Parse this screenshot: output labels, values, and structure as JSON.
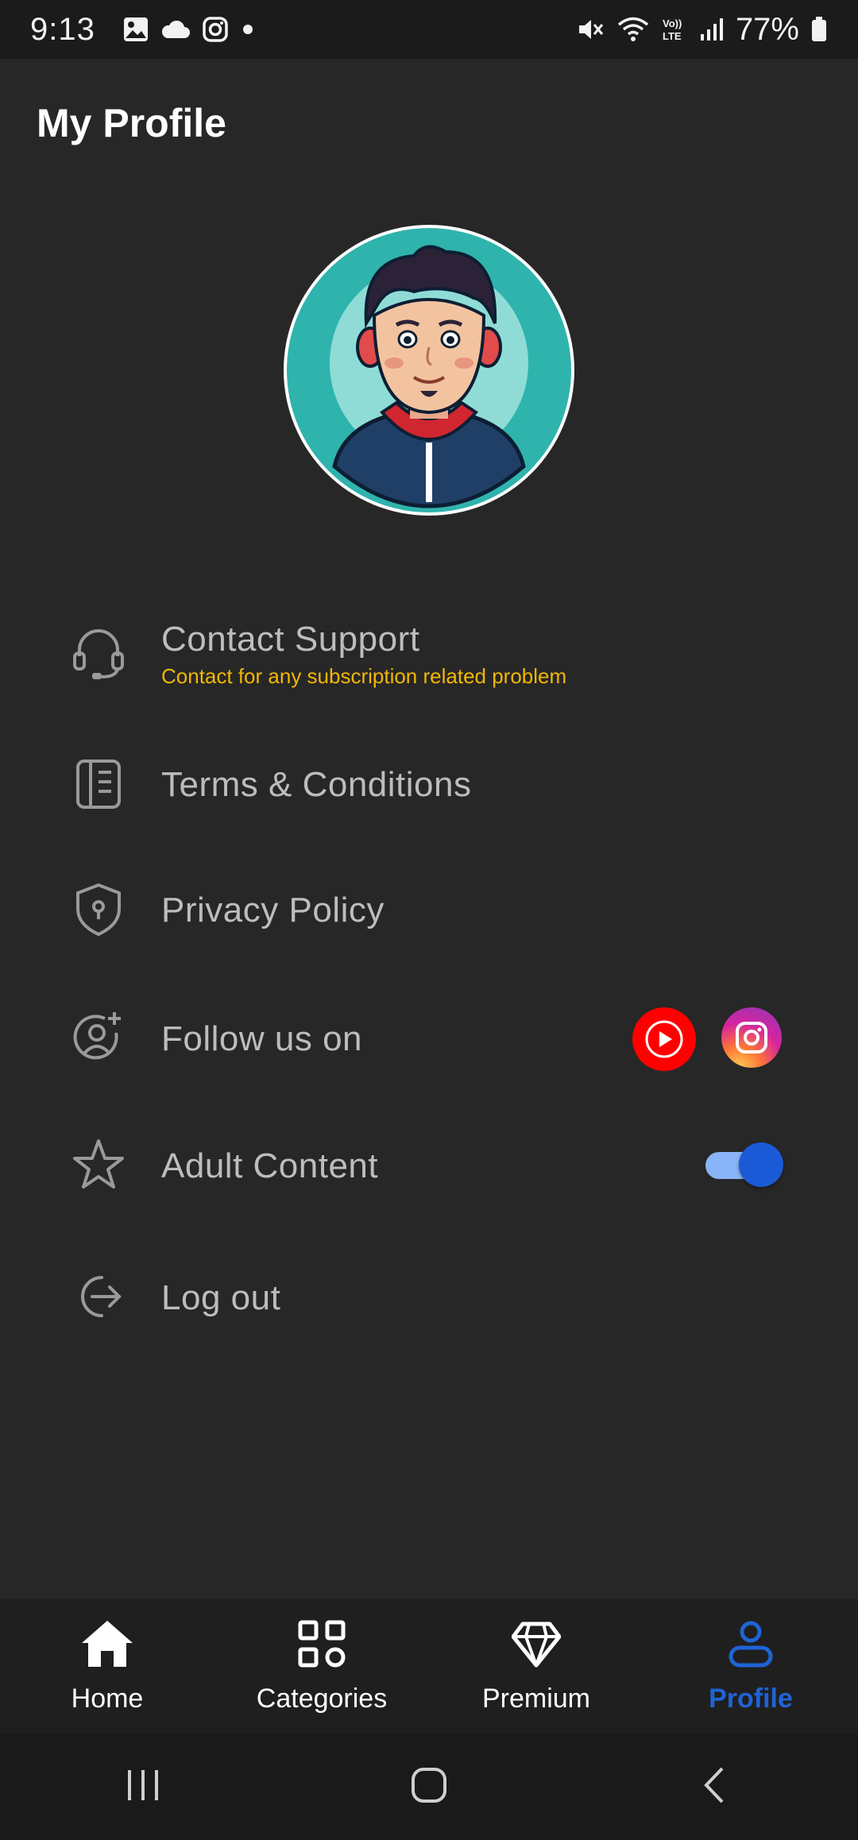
{
  "status_bar": {
    "time": "9:13",
    "battery": "77%",
    "icons": [
      "gallery-icon",
      "cloud-icon",
      "instagram-icon",
      "dot-icon",
      "mute-icon",
      "wifi-icon",
      "volte-icon",
      "signal-icon",
      "battery-icon"
    ]
  },
  "header": {
    "title": "My Profile"
  },
  "menu": {
    "contact_support": {
      "label": "Contact Support",
      "subtitle": "Contact for any subscription related problem",
      "icon": "headset-icon"
    },
    "terms": {
      "label": "Terms & Conditions",
      "icon": "document-icon"
    },
    "privacy": {
      "label": "Privacy Policy",
      "icon": "shield-icon"
    },
    "follow": {
      "label": "Follow us on",
      "icon": "user-plus-icon",
      "socials": [
        "youtube-icon",
        "instagram-icon"
      ]
    },
    "adult": {
      "label": "Adult Content",
      "icon": "star-icon",
      "enabled": true
    },
    "logout": {
      "label": "Log out",
      "icon": "logout-icon"
    }
  },
  "bottom_nav": {
    "items": [
      {
        "label": "Home",
        "icon": "home-icon"
      },
      {
        "label": "Categories",
        "icon": "categories-icon"
      },
      {
        "label": "Premium",
        "icon": "diamond-icon"
      },
      {
        "label": "Profile",
        "icon": "profile-icon",
        "active": true
      }
    ]
  },
  "colors": {
    "accent": "#1f63d6",
    "subtitle": "#f2b705",
    "background": "#272727"
  }
}
